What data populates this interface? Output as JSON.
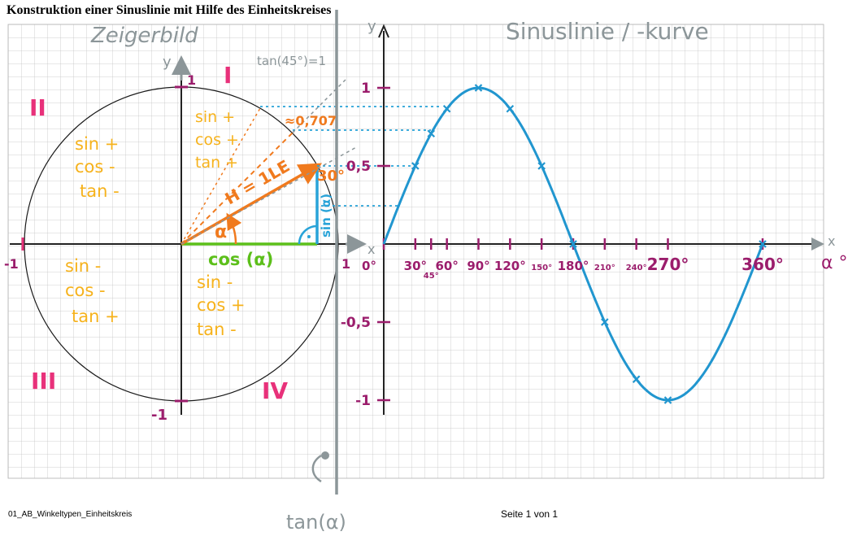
{
  "page": {
    "title": "Konstruktion einer Sinuslinie mit Hilfe des Einheitskreises",
    "footer_file": "01_AB_Winkeltypen_Einheitskreis",
    "footer_page": "Seite 1 von 1"
  },
  "colors": {
    "grid": "#bdbdbd",
    "circle": "#1a1a1a",
    "quadrant": "#e8317a",
    "sign": "#f6b21c",
    "cosine": "#5cbf1a",
    "hypotenuse": "#f07a1e",
    "sine_segment": "#29a3d8",
    "curve": "#2196cf",
    "labels": "#9b1d6c",
    "pencil": "#8c9699"
  },
  "unit_circle": {
    "heading": "Zeigerbild",
    "axis_y": "y",
    "axis_x": "x",
    "tick_top": "1",
    "tick_bottom": "-1",
    "tick_left": "-1",
    "tick_right": "1",
    "quadrants": {
      "q1": "I",
      "q2": "II",
      "q3": "III",
      "q4": "IV"
    },
    "signs": {
      "q1": [
        "sin +",
        "cos +",
        "tan +"
      ],
      "q2": [
        "sin +",
        "cos -",
        "tan -"
      ],
      "q3": [
        "sin -",
        "cos -",
        "tan +"
      ],
      "q4": [
        "sin -",
        "cos +",
        "tan -"
      ]
    },
    "cos_label": "cos (α)",
    "sin_label": "sin (α)",
    "alpha_label": "α",
    "hyp_label": "H = 1LE",
    "angle_label": "30°",
    "value_0707": "≈0,707",
    "tan45_label": "tan(45°)=1",
    "tan_label": "tan(α)"
  },
  "chart_data": {
    "type": "line",
    "title": "Sinuslinie / -kurve",
    "xlabel": "α °",
    "ylabel": "y",
    "x_axis_mark": "x",
    "x_tick_labels": [
      {
        "x": 0,
        "label": "0°"
      },
      {
        "x": 30,
        "label": "30°"
      },
      {
        "x": 45,
        "label": "45°"
      },
      {
        "x": 60,
        "label": "60°"
      },
      {
        "x": 90,
        "label": "90°"
      },
      {
        "x": 120,
        "label": "120°"
      },
      {
        "x": 150,
        "label": "150°"
      },
      {
        "x": 180,
        "label": "180°"
      },
      {
        "x": 210,
        "label": "210°"
      },
      {
        "x": 240,
        "label": "240°"
      },
      {
        "x": 270,
        "label": "270°"
      },
      {
        "x": 360,
        "label": "360°"
      }
    ],
    "y_tick_labels": [
      {
        "y": 1,
        "label": "1"
      },
      {
        "y": 0.5,
        "label": "0,5"
      },
      {
        "y": -0.5,
        "label": "-0,5"
      },
      {
        "y": -1,
        "label": "-1"
      }
    ],
    "xlim": [
      0,
      360
    ],
    "ylim": [
      -1,
      1
    ],
    "series": [
      {
        "x": [
          0,
          15,
          30,
          45,
          60,
          75,
          90,
          105,
          120,
          135,
          150,
          165,
          180,
          195,
          210,
          225,
          240,
          255,
          270,
          285,
          300,
          315,
          330,
          345,
          360
        ],
        "values": [
          0,
          0.259,
          0.5,
          0.707,
          0.866,
          0.966,
          1,
          0.966,
          0.866,
          0.707,
          0.5,
          0.259,
          0,
          -0.259,
          -0.5,
          -0.707,
          -0.866,
          -0.966,
          -1,
          -0.966,
          -0.866,
          -0.707,
          -0.5,
          -0.259,
          0
        ]
      }
    ],
    "marked_points_x": [
      30,
      45,
      60,
      90,
      120,
      150,
      180,
      210,
      240,
      270,
      360
    ],
    "grid": true
  }
}
